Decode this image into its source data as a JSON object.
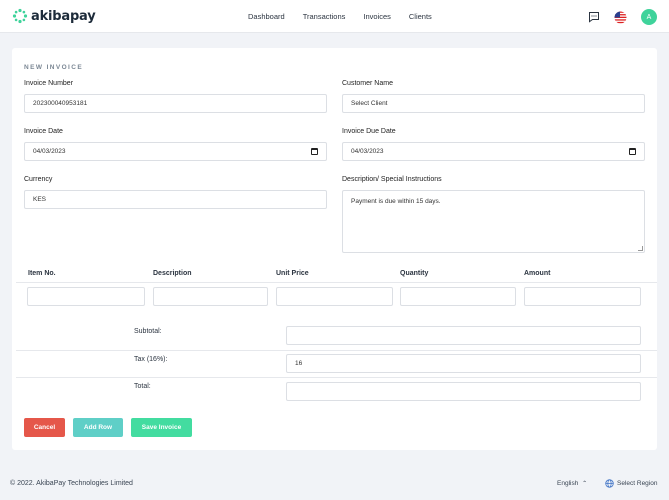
{
  "brand": {
    "name": "akibapay",
    "accent": "#3fd39b"
  },
  "nav": [
    "Dashboard",
    "Transactions",
    "Invoices",
    "Clients"
  ],
  "header_icons": {
    "chat": "chat-icon",
    "flag": "us-flag-icon",
    "avatar_letter": "A"
  },
  "form": {
    "section_title": "NEW INVOICE",
    "invoice_number": {
      "label": "Invoice Number",
      "value": "202300040953181"
    },
    "customer_name": {
      "label": "Customer Name",
      "value": "Select Client"
    },
    "invoice_date": {
      "label": "Invoice Date",
      "value": "04/03/2023"
    },
    "due_date": {
      "label": "Invoice Due Date",
      "value": "04/03/2023"
    },
    "currency": {
      "label": "Currency",
      "value": "KES"
    },
    "description": {
      "label": "Description/ Special Instructions",
      "value": "Payment is due within 15 days."
    }
  },
  "items_table": {
    "columns": [
      "Item No.",
      "Description",
      "Unit Price",
      "Quantity",
      "Amount"
    ],
    "row": [
      "",
      "",
      "",
      "",
      ""
    ]
  },
  "summary": {
    "subtotal_label": "Subtotal:",
    "subtotal_value": "",
    "tax_label": "Tax (16%):",
    "tax_value": "16",
    "total_label": "Total:",
    "total_value": ""
  },
  "buttons": {
    "cancel": "Cancel",
    "add_row": "Add Row",
    "save": "Save Invoice"
  },
  "colors": {
    "cancel": "#e5574a",
    "add_row": "#5fcfc7",
    "save": "#43dca0"
  },
  "footer": {
    "copyright": "© 2022. AkibaPay Technologies Limited",
    "language": "English",
    "region": "Select Region"
  }
}
